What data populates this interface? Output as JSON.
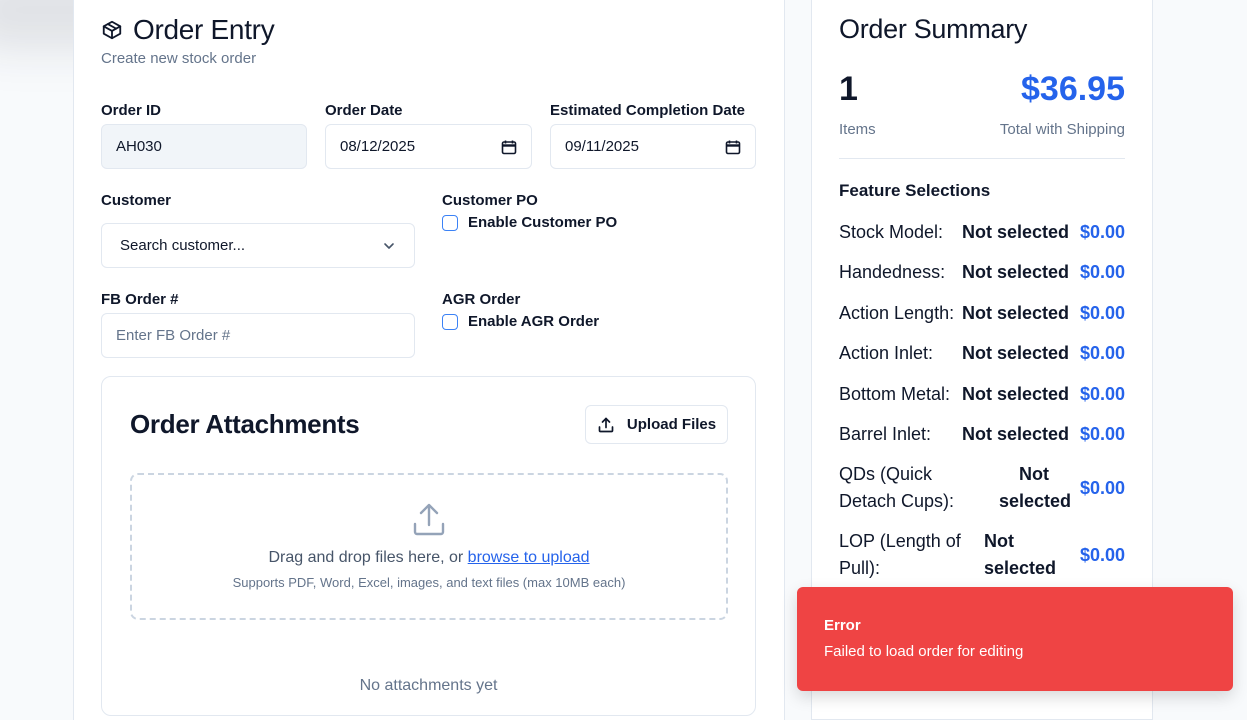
{
  "header": {
    "title": "Order Entry",
    "subtitle": "Create new stock order",
    "icon": "package-icon"
  },
  "form": {
    "order_id": {
      "label": "Order ID",
      "value": "AH030"
    },
    "order_date": {
      "label": "Order Date",
      "value": "08/12/2025"
    },
    "est_completion": {
      "label": "Estimated Completion Date",
      "value": "09/11/2025"
    },
    "customer": {
      "label": "Customer",
      "placeholder": "Search customer..."
    },
    "customer_po": {
      "label": "Customer PO",
      "checkbox_label": "Enable Customer PO",
      "checked": false
    },
    "fb_order": {
      "label": "FB Order #",
      "placeholder": "Enter FB Order #"
    },
    "agr_order": {
      "label": "AGR Order",
      "checkbox_label": "Enable AGR Order",
      "checked": false
    }
  },
  "attachments": {
    "title": "Order Attachments",
    "upload_label": "Upload Files",
    "drop_text": "Drag and drop files here, or ",
    "drop_link": "browse to upload",
    "drop_sub": "Supports PDF, Word, Excel, images, and text files (max 10MB each)",
    "empty_text": "No attachments yet"
  },
  "summary": {
    "title": "Order Summary",
    "items_count": "1",
    "items_label": "Items",
    "total": "$36.95",
    "total_label": "Total with Shipping",
    "features_title": "Feature Selections",
    "features": [
      {
        "name": "Stock Model:",
        "status": "Not selected",
        "price": "$0.00"
      },
      {
        "name": "Handedness:",
        "status": "Not selected",
        "price": "$0.00"
      },
      {
        "name": "Action Length:",
        "status": "Not selected",
        "price": "$0.00"
      },
      {
        "name": "Action Inlet:",
        "status": "Not selected",
        "price": "$0.00"
      },
      {
        "name": "Bottom Metal:",
        "status": "Not selected",
        "price": "$0.00"
      },
      {
        "name": "Barrel Inlet:",
        "status": "Not selected",
        "price": "$0.00"
      },
      {
        "name": "QDs (Quick Detach Cups):",
        "status": "Not selected",
        "price": "$0.00"
      },
      {
        "name": "LOP (Length of Pull):",
        "status": "Not selected",
        "price": "$0.00"
      }
    ]
  },
  "toast": {
    "title": "Error",
    "message": "Failed to load order for editing",
    "color": "#ef4444"
  },
  "colors": {
    "accent": "#2563eb",
    "error": "#ef4444"
  }
}
